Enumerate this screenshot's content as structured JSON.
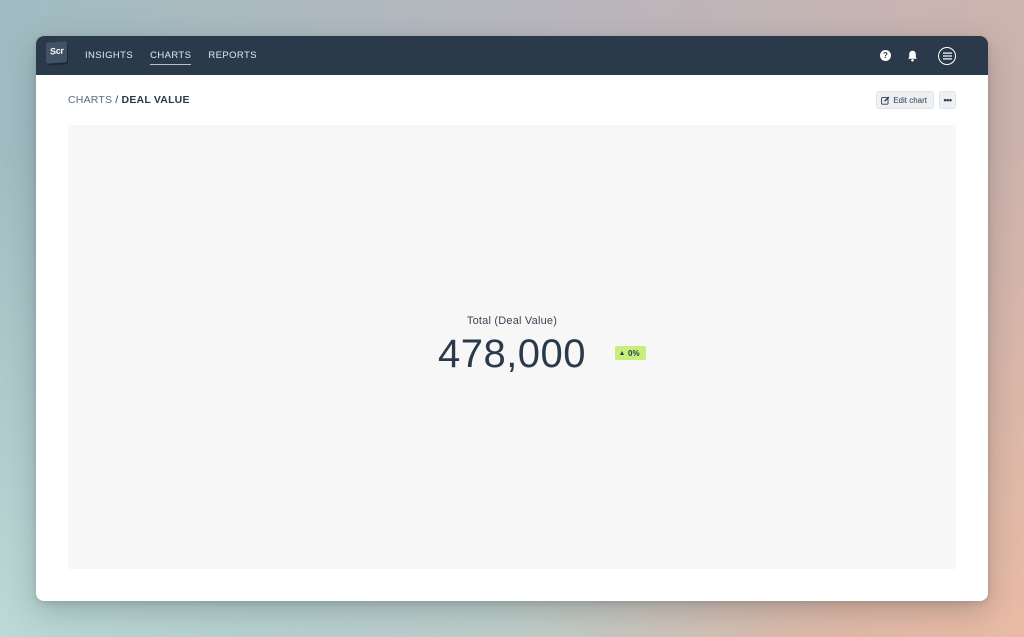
{
  "app": {
    "logo_text": "Scr"
  },
  "nav": {
    "items": [
      {
        "label": "INSIGHTS"
      },
      {
        "label": "CHARTS"
      },
      {
        "label": "REPORTS"
      }
    ],
    "active": "CHARTS",
    "icons": [
      "help-icon",
      "bell-icon",
      "menu-icon"
    ]
  },
  "breadcrumb": {
    "parent": "CHARTS",
    "separator": " / ",
    "current": "DEAL VALUE"
  },
  "actions": {
    "edit_label": "Edit chart",
    "more_label": "•••"
  },
  "metric": {
    "label": "Total (Deal Value)",
    "value": "478,000",
    "change": "0%",
    "change_direction": "up"
  },
  "colors": {
    "nav_bg": "#2b3a4b",
    "badge_bg": "#c7f07a",
    "chart_bg": "#f7f7f7"
  }
}
